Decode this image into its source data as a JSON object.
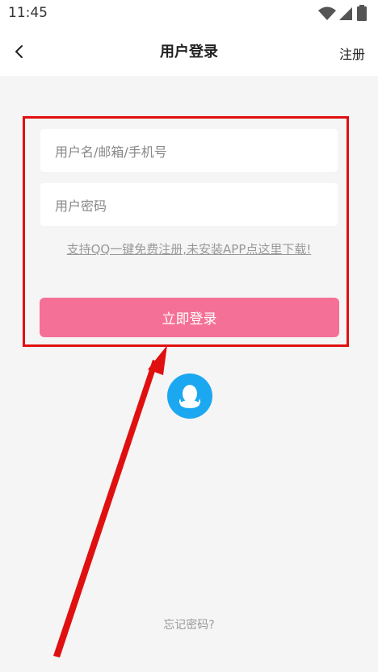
{
  "status_bar": {
    "time": "11:45"
  },
  "header": {
    "title": "用户登录",
    "register_label": "注册"
  },
  "login_form": {
    "username_placeholder": "用户名/邮箱/手机号",
    "password_placeholder": "用户密码",
    "qq_register_text": "支持QQ一键免费注册,未安装APP点这里下载!",
    "login_button_label": "立即登录"
  },
  "footer": {
    "forgot_password_label": "忘记密码?"
  },
  "icons": {
    "back": "chevron-left-icon",
    "qq": "qq-penguin-icon",
    "wifi": "wifi-icon",
    "signal": "signal-icon",
    "battery": "battery-icon"
  },
  "colors": {
    "login_button": "#f57096",
    "qq_button": "#1ca8f0",
    "highlight_box": "#e01010",
    "background": "#f5f5f5"
  }
}
